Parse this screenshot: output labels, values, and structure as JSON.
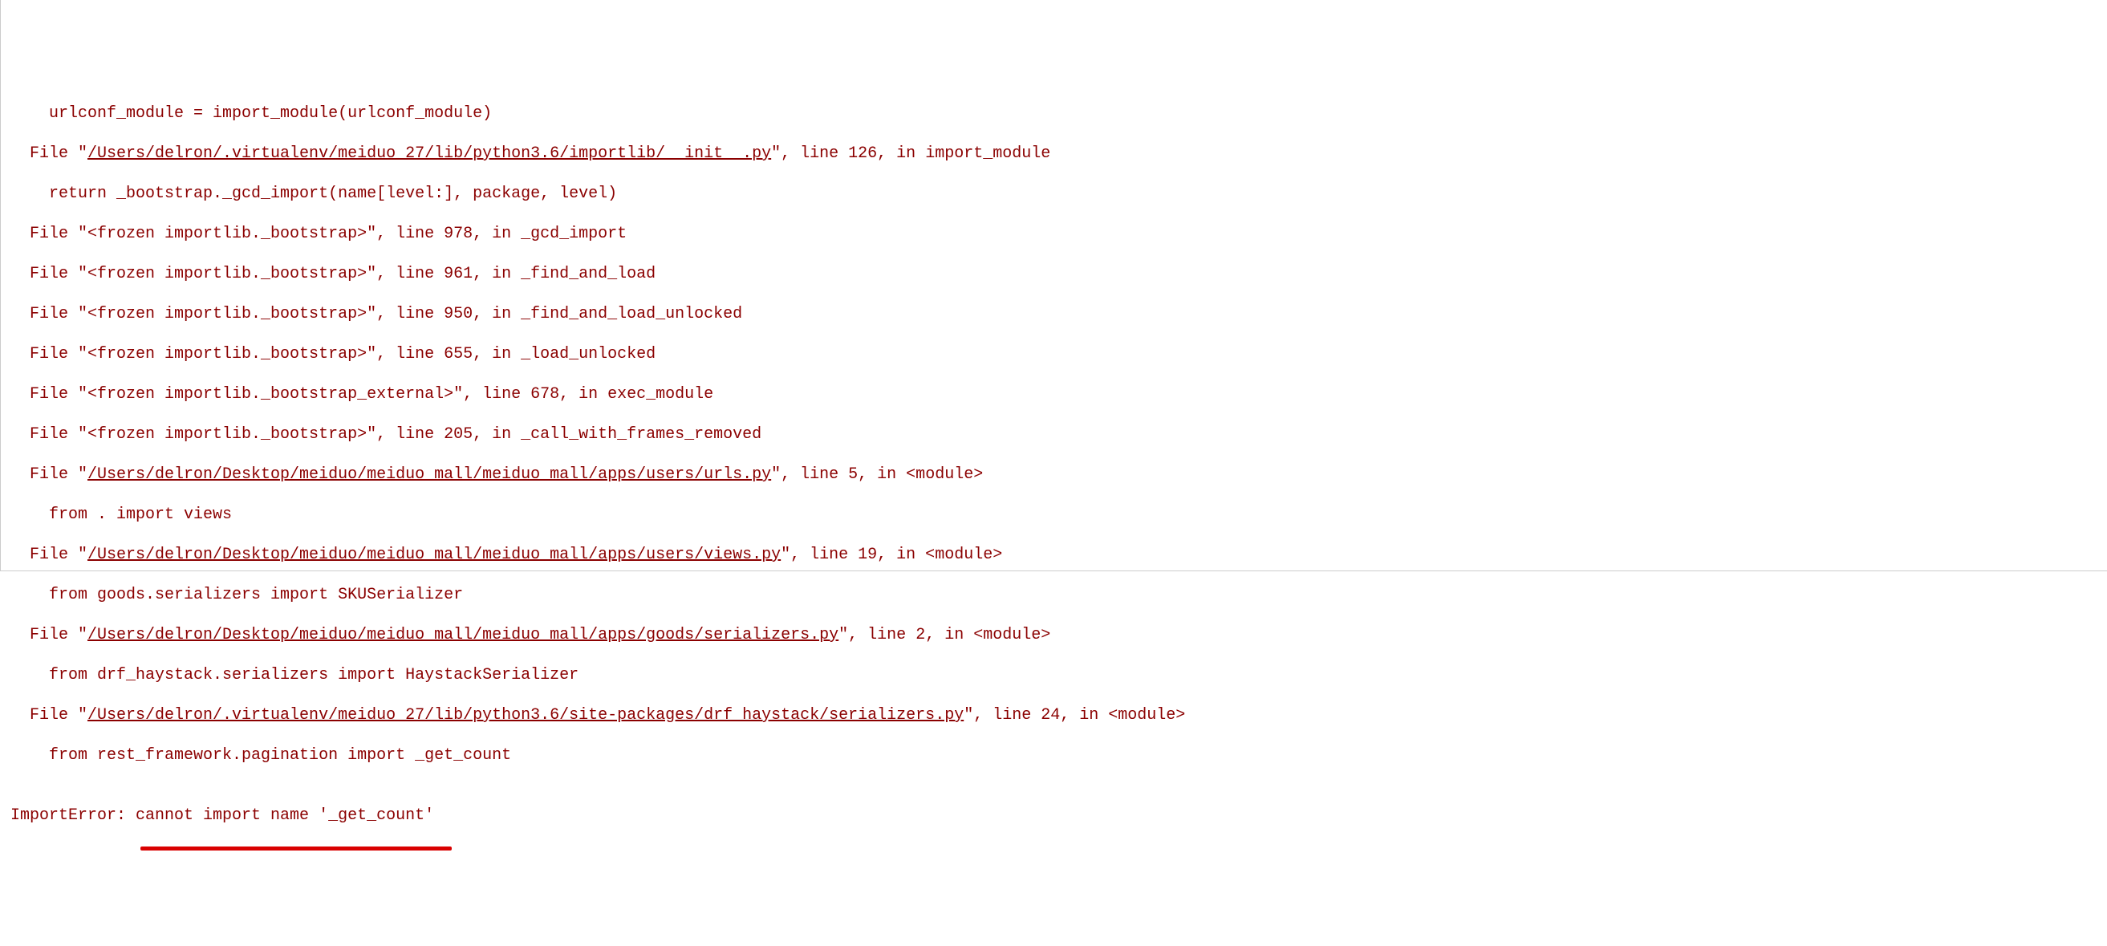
{
  "lines": [
    {
      "indent": 4,
      "text": "    urlconf_module = import_module(urlconf_module)"
    },
    {
      "indent": 2,
      "prefix": "  File \"",
      "link": "/Users/delron/.virtualenv/meiduo_27/lib/python3.6/importlib/__init__.py",
      "suffix": "\", line 126, in import_module"
    },
    {
      "indent": 4,
      "text": "    return _bootstrap._gcd_import(name[level:], package, level)"
    },
    {
      "indent": 2,
      "text": "  File \"<frozen importlib._bootstrap>\", line 978, in _gcd_import"
    },
    {
      "indent": 2,
      "text": "  File \"<frozen importlib._bootstrap>\", line 961, in _find_and_load"
    },
    {
      "indent": 2,
      "text": "  File \"<frozen importlib._bootstrap>\", line 950, in _find_and_load_unlocked"
    },
    {
      "indent": 2,
      "text": "  File \"<frozen importlib._bootstrap>\", line 655, in _load_unlocked"
    },
    {
      "indent": 2,
      "text": "  File \"<frozen importlib._bootstrap_external>\", line 678, in exec_module"
    },
    {
      "indent": 2,
      "text": "  File \"<frozen importlib._bootstrap>\", line 205, in _call_with_frames_removed"
    },
    {
      "indent": 2,
      "prefix": "  File \"",
      "link": "/Users/delron/Desktop/meiduo/meiduo_mall/meiduo_mall/apps/users/urls.py",
      "suffix": "\", line 5, in <module>"
    },
    {
      "indent": 4,
      "text": "    from . import views"
    },
    {
      "indent": 2,
      "prefix": "  File \"",
      "link": "/Users/delron/Desktop/meiduo/meiduo_mall/meiduo_mall/apps/users/views.py",
      "suffix": "\", line 19, in <module>"
    },
    {
      "indent": 4,
      "text": "    from goods.serializers import SKUSerializer"
    },
    {
      "indent": 2,
      "prefix": "  File \"",
      "link": "/Users/delron/Desktop/meiduo/meiduo_mall/meiduo_mall/apps/goods/serializers.py",
      "suffix": "\", line 2, in <module>"
    },
    {
      "indent": 4,
      "text": "    from drf_haystack.serializers import HaystackSerializer"
    },
    {
      "indent": 2,
      "prefix": "  File \"",
      "link": "/Users/delron/.virtualenv/meiduo_27/lib/python3.6/site-packages/drf_haystack/serializers.py",
      "suffix": "\", line 24, in <module>"
    },
    {
      "indent": 4,
      "text": "    from rest_framework.pagination import _get_count"
    }
  ],
  "error_line": "ImportError: cannot import name '_get_count'"
}
